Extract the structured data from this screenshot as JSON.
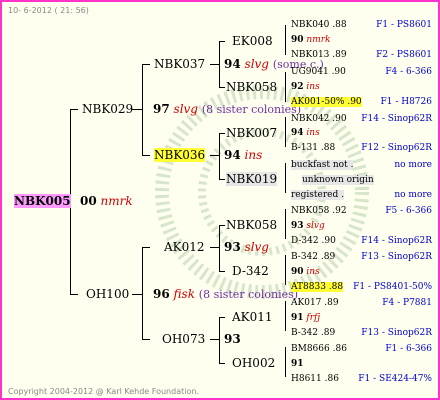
{
  "header": {
    "stamp": "10- 6-2012 ( 21: 56)"
  },
  "footer": {
    "copyright": "Copyright 2004-2012 @ Karl Kehde Foundation."
  },
  "root": {
    "name": "NBK005",
    "num": "00",
    "tag": "nmrk"
  },
  "g1": {
    "top": {
      "name": "NBK029"
    },
    "bottom": {
      "name": "OH100"
    }
  },
  "g2": [
    {
      "name": "NBK037",
      "num": "97",
      "tag": "slvg",
      "note": "(8 sister colonies)"
    },
    {
      "name": "NBK036",
      "num": "94",
      "tag": "ins"
    },
    {
      "name": "AK012",
      "num": "96",
      "tag": "fisk",
      "note": "(8 sister colonies)"
    },
    {
      "name": "OH073",
      "num": "93"
    }
  ],
  "g3": [
    {
      "name": "EK008",
      "num": "94",
      "tag": "slvg",
      "note": "(some c.)"
    },
    {
      "name": "NBK058",
      "num": "92",
      "tag": "ins"
    },
    {
      "name": "NBK007",
      "num": "94",
      "tag": "ins"
    },
    {
      "name": "NBK019"
    },
    {
      "name": "NBK058",
      "num": "93",
      "tag": "slvg"
    },
    {
      "name": "D-342",
      "num": "90",
      "tag": "ins"
    },
    {
      "name": "AK011",
      "num": "91",
      "tag": "frfj"
    },
    {
      "name": "OH002",
      "num": "91"
    }
  ],
  "g4": [
    {
      "id": "NBK040",
      "val": ".88",
      "src": "F1 - PS8601"
    },
    {
      "id": "NBK013",
      "val": ".89",
      "src": "F2 - PS8601"
    },
    {
      "id": "UG9041",
      "val": ".90",
      "src": "F4 - 6-366"
    },
    {
      "id": "AK001-50%",
      "val": ".90",
      "src": "F1 - H8726"
    },
    {
      "id": "NBK042",
      "val": ".90",
      "src": "F14 - Sinop62R"
    },
    {
      "id": "B-131",
      "val": ".88",
      "src": "F12 - Sinop62R"
    },
    {
      "id": "buckfast not",
      "val": ".",
      "src": "no more"
    },
    {
      "id": "unknown origin",
      "val": "",
      "src": ""
    },
    {
      "id": "registered",
      "val": ".",
      "src": "no more"
    },
    {
      "id": "NBK058",
      "val": ".92",
      "src": "F5 - 6-366"
    },
    {
      "id": "D-342",
      "val": ".90",
      "src": "F14 - Sinop62R"
    },
    {
      "id": "B-342",
      "val": ".89",
      "src": "F13 - Sinop62R"
    },
    {
      "id": "AT8833",
      "val": ".88",
      "src": "F1 - PS8401-50%"
    },
    {
      "id": "AK017",
      "val": ".89",
      "src": "F4 - P7881"
    },
    {
      "id": "B-342",
      "val": ".89",
      "src": "F13 - Sinop62R"
    },
    {
      "id": "BM8666",
      "val": ".86",
      "src": "F1 - 6-366"
    },
    {
      "id": "H8611",
      "val": ".86",
      "src": "F1 - SE424-47%"
    }
  ],
  "g4tags": [
    {
      "num": "90",
      "tag": "nmrk"
    },
    {
      "num": "92",
      "tag": "ins"
    },
    {
      "num": "93",
      "tag": "slvg"
    },
    {
      "num": "90",
      "tag": "ins"
    },
    {
      "num": "91",
      "tag": "frfj"
    },
    {
      "num": "91",
      "tag": ""
    }
  ]
}
